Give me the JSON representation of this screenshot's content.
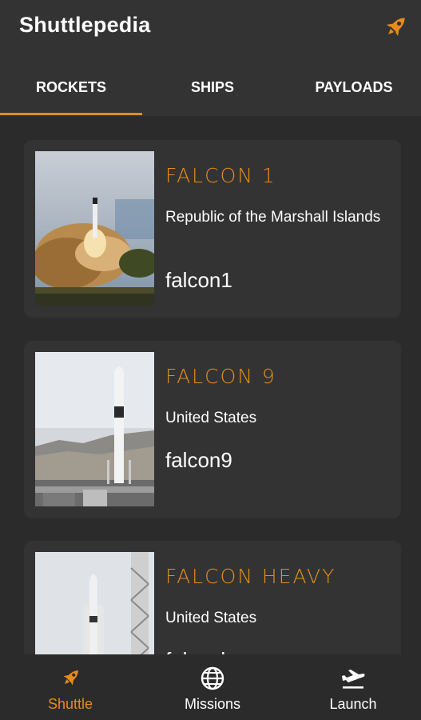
{
  "app": {
    "title": "Shuttlepedia",
    "accent": "#e58c1c"
  },
  "tabs": [
    {
      "label": "ROCKETS",
      "selected": true
    },
    {
      "label": "SHIPS",
      "selected": false
    },
    {
      "label": "PAYLOADS",
      "selected": false
    }
  ],
  "rockets": [
    {
      "name": "FALCON 1",
      "country": "Republic of the Marshall Islands",
      "id": "falcon1"
    },
    {
      "name": "FALCON 9",
      "country": "United States",
      "id": "falcon9"
    },
    {
      "name": "FALCON HEAVY",
      "country": "United States",
      "id": "falconheavy"
    }
  ],
  "bottom_nav": [
    {
      "label": "Shuttle",
      "icon": "rocket-icon",
      "selected": true
    },
    {
      "label": "Missions",
      "icon": "globe-icon",
      "selected": false
    },
    {
      "label": "Launch",
      "icon": "takeoff-icon",
      "selected": false
    }
  ]
}
